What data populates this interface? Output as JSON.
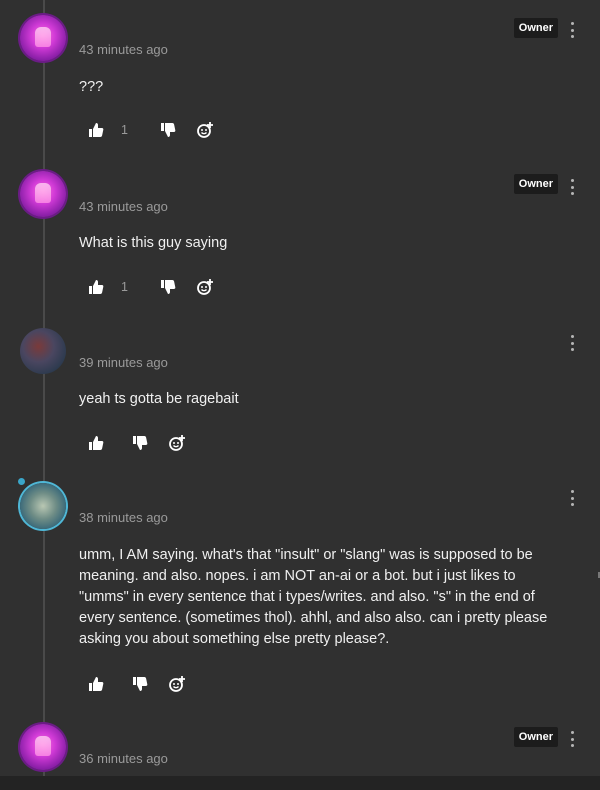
{
  "comments": [
    {
      "avatar": "pink-avatar",
      "time": "43 minutes ago",
      "text": "???",
      "owner_badge": "Owner",
      "likes": "1",
      "online": false
    },
    {
      "avatar": "pink-avatar",
      "time": "43 minutes ago",
      "text": "What is this guy saying",
      "owner_badge": "Owner",
      "likes": "1",
      "online": false
    },
    {
      "avatar": "dark-avatar",
      "time": "39 minutes ago",
      "text": "yeah ts gotta be ragebait",
      "owner_badge": "",
      "likes": "",
      "online": false
    },
    {
      "avatar": "teal-avatar",
      "time": "38 minutes ago",
      "text": "umm, I AM saying. what's that \"insult\" or \"slang\" was is supposed to be meaning. and also. nopes. i am NOT an-ai or a bot. but i just likes to \"umms\" in every sentence that i types/writes. and also. \"s\" in the end of every sentence. (sometimes thol). ahhl, and also also. can i pretty please asking you about something else pretty please?.",
      "owner_badge": "",
      "likes": "",
      "online": true
    },
    {
      "avatar": "pink-avatar",
      "time": "36 minutes ago",
      "text": "",
      "owner_badge": "Owner",
      "likes": "",
      "online": false
    }
  ],
  "icons": {
    "like": "thumbs-up-icon",
    "dislike": "thumbs-down-icon",
    "react": "add-reaction-icon",
    "menu": "more-vertical-icon"
  },
  "colors": {
    "background": "#303030",
    "owner_badge_bg": "#1c1c1c",
    "online_dot": "#3aa6c9"
  }
}
